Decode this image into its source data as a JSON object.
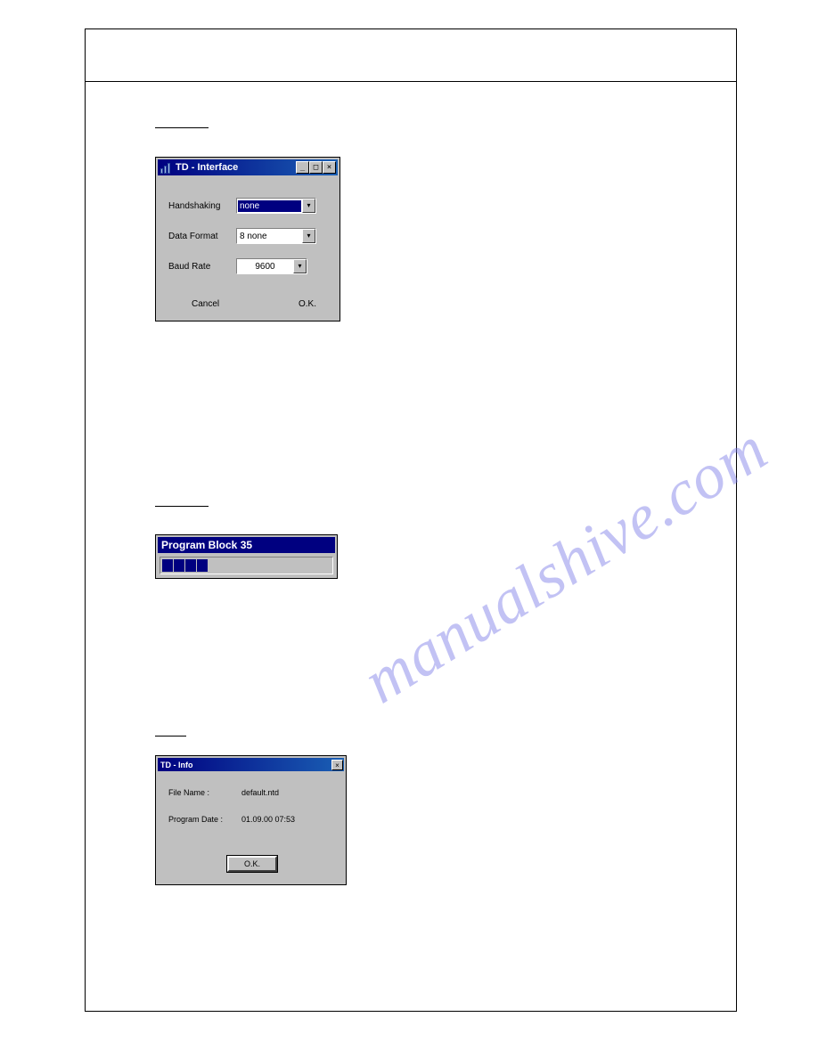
{
  "watermark": "manualshive.com",
  "dialog_interface": {
    "title": "TD - Interface",
    "rows": {
      "handshaking": {
        "label": "Handshaking",
        "value": "none"
      },
      "data_format": {
        "label": "Data Format",
        "value": "8 none"
      },
      "baud_rate": {
        "label": "Baud Rate",
        "value": "9600"
      }
    },
    "cancel": "Cancel",
    "ok": "O.K."
  },
  "progress": {
    "title": "Program  Block 35",
    "filled_segments": 4
  },
  "dialog_info": {
    "title": "TD - Info",
    "file_name_label": "File Name :",
    "file_name_value": "default.ntd",
    "program_date_label": "Program Date :",
    "program_date_value": "01.09.00  07:53",
    "ok": "O.K."
  },
  "window_controls": {
    "minimize": "_",
    "maximize": "□",
    "close": "×",
    "dropdown": "▾"
  }
}
